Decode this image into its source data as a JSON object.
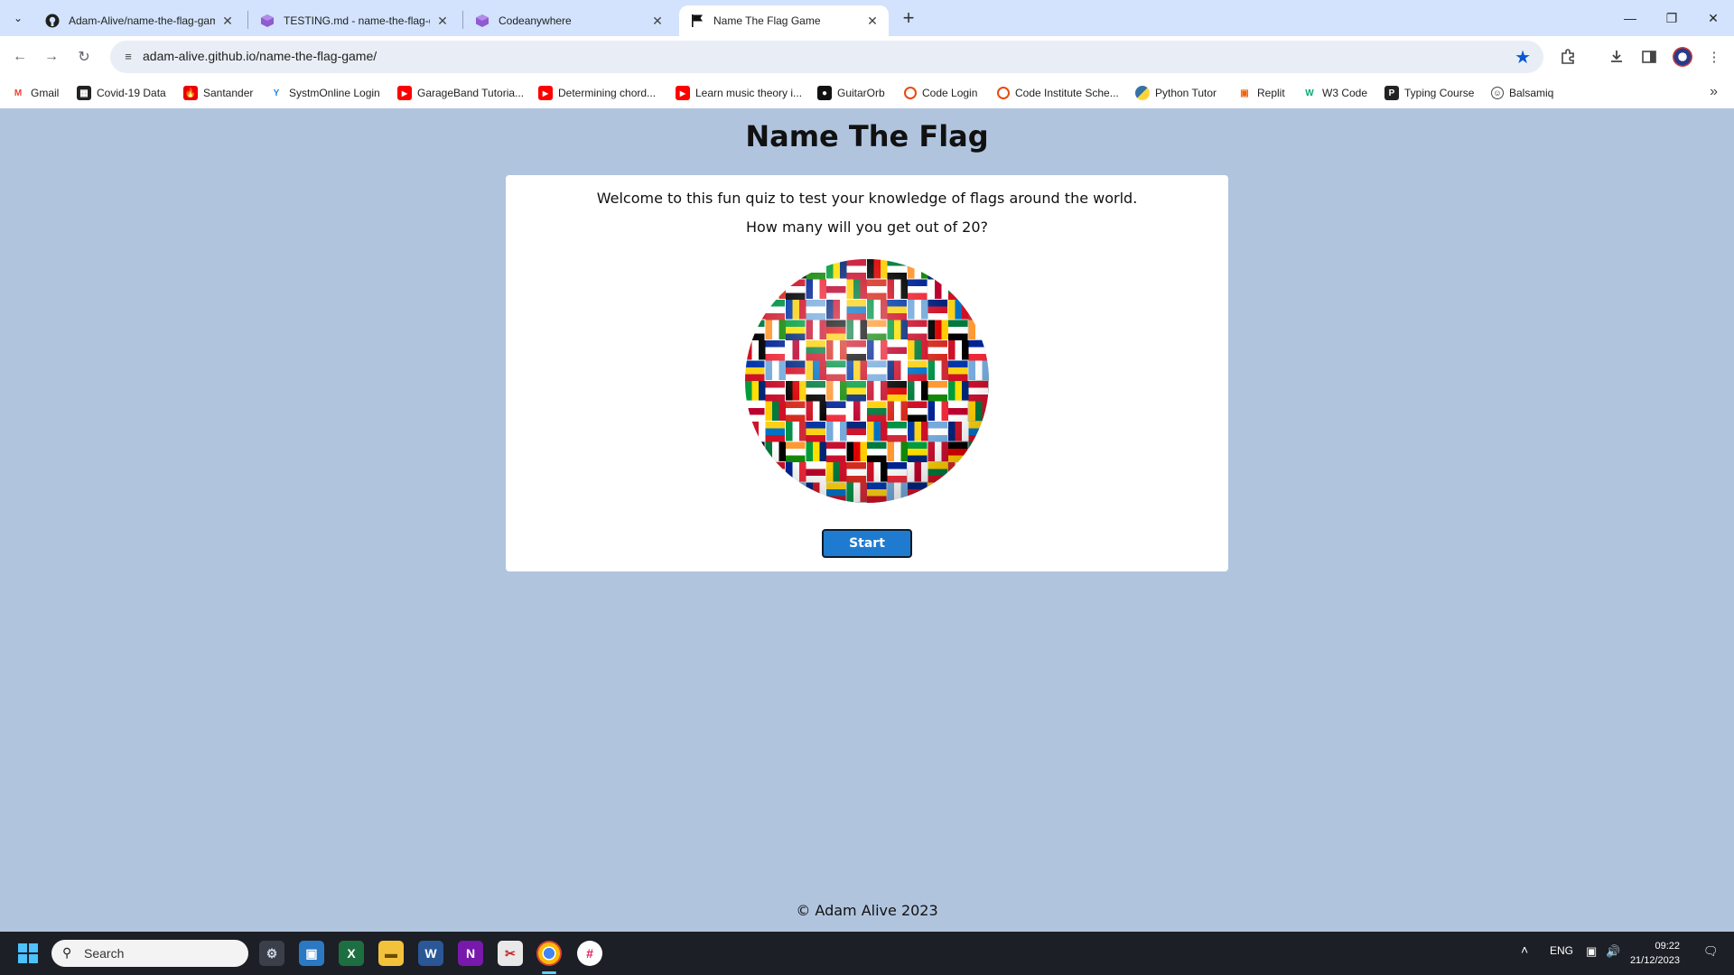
{
  "browser": {
    "tabs": [
      {
        "title": "Adam-Alive/name-the-flag-gam",
        "icon": "github-icon"
      },
      {
        "title": "TESTING.md - name-the-flag-g",
        "icon": "codeanywhere-icon"
      },
      {
        "title": "Codeanywhere",
        "icon": "codeanywhere-icon"
      },
      {
        "title": "Name The Flag Game",
        "icon": "flag-icon"
      }
    ],
    "url": "adam-alive.github.io/name-the-flag-game/",
    "bookmarks": [
      {
        "label": "Gmail",
        "icon": "gmail-icon",
        "color": "#ea4335"
      },
      {
        "label": "Covid-19 Data",
        "icon": "covid-data-icon",
        "color": "#222222"
      },
      {
        "label": "Santander",
        "icon": "santander-icon",
        "color": "#ec0000"
      },
      {
        "label": "SystmOnline Login",
        "icon": "systmonline-icon",
        "color": "#1e88e5"
      },
      {
        "label": "GarageBand Tutoria...",
        "icon": "youtube-icon",
        "color": "#ff0000"
      },
      {
        "label": "Determining chord...",
        "icon": "youtube-icon",
        "color": "#ff0000"
      },
      {
        "label": "Learn music theory i...",
        "icon": "youtube-icon",
        "color": "#ff0000"
      },
      {
        "label": "GuitarOrb",
        "icon": "guitarorb-icon",
        "color": "#111111"
      },
      {
        "label": "Code Login",
        "icon": "code-login-icon",
        "color": "#e8490f"
      },
      {
        "label": "Code Institute Sche...",
        "icon": "code-institute-icon",
        "color": "#e8490f"
      },
      {
        "label": "Python Tutor",
        "icon": "python-icon",
        "color": "#3572a5"
      },
      {
        "label": "Replit",
        "icon": "replit-icon",
        "color": "#f26207"
      },
      {
        "label": "W3 Code",
        "icon": "w3-icon",
        "color": "#04aa6d"
      },
      {
        "label": "Typing Course",
        "icon": "typing-course-icon",
        "color": "#222222"
      },
      {
        "label": "Balsamiq",
        "icon": "balsamiq-icon",
        "color": "#444444"
      }
    ]
  },
  "page": {
    "title": "Name The Flag",
    "welcome": "Welcome to this fun quiz to test your knowledge of flags around the world.",
    "question": "How many will you get out of 20?",
    "start_label": "Start",
    "footer": "© Adam Alive 2023",
    "background": "#b0c4de",
    "accent": "#1f7bd0"
  },
  "taskbar": {
    "search_placeholder": "Search",
    "language": "ENG",
    "time": "09:22",
    "date": "21/12/2023",
    "apps": [
      "settings-icon",
      "remote-desktop-icon",
      "excel-icon",
      "file-explorer-icon",
      "word-icon",
      "onenote-icon",
      "snipping-tool-icon",
      "chrome-icon",
      "slack-icon"
    ]
  }
}
